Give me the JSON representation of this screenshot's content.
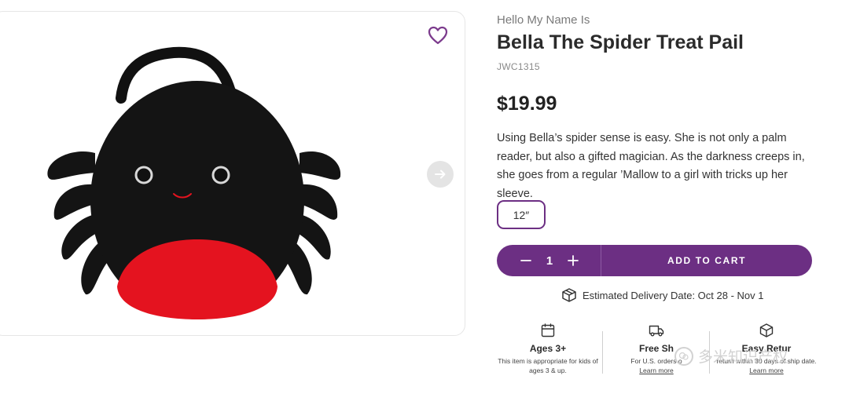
{
  "product": {
    "eyebrow": "Hello My Name Is",
    "title": "Bella The Spider Treat Pail",
    "sku": "JWC1315",
    "price": "$19.99",
    "description": "Using Bella’s spider sense is easy. She is not only a palm reader, but also a gifted magician. As the darkness creeps in, she goes from a regular ’Mallow to a girl with tricks up her sleeve.",
    "size_option": "12″"
  },
  "image_card": {
    "wishlist_icon": "heart-outline-icon",
    "next_icon": "arrow-right-icon",
    "image_subject": "black spider treat pail plush"
  },
  "cart": {
    "quantity": "1",
    "add_label": "ADD TO CART"
  },
  "delivery": {
    "icon": "package-icon",
    "text": "Estimated Delivery Date: Oct 28 - Nov 1"
  },
  "features": [
    {
      "icon": "calendar-icon",
      "heading": "Ages 3+",
      "body": "This item is appropriate for kids of ages 3 & up."
    },
    {
      "icon": "truck-icon",
      "heading": "Free Sh",
      "body": "For U.S. orders o",
      "link": "Learn more"
    },
    {
      "icon": "box-icon",
      "heading": "Easy Retur",
      "body": "return within 30 days of ship date.",
      "link": "Learn more"
    }
  ],
  "watermark": {
    "text": "多米知识产权"
  },
  "colors": {
    "brand_purple": "#6c2f83",
    "wishlist_heart": "#7b3a8c"
  }
}
